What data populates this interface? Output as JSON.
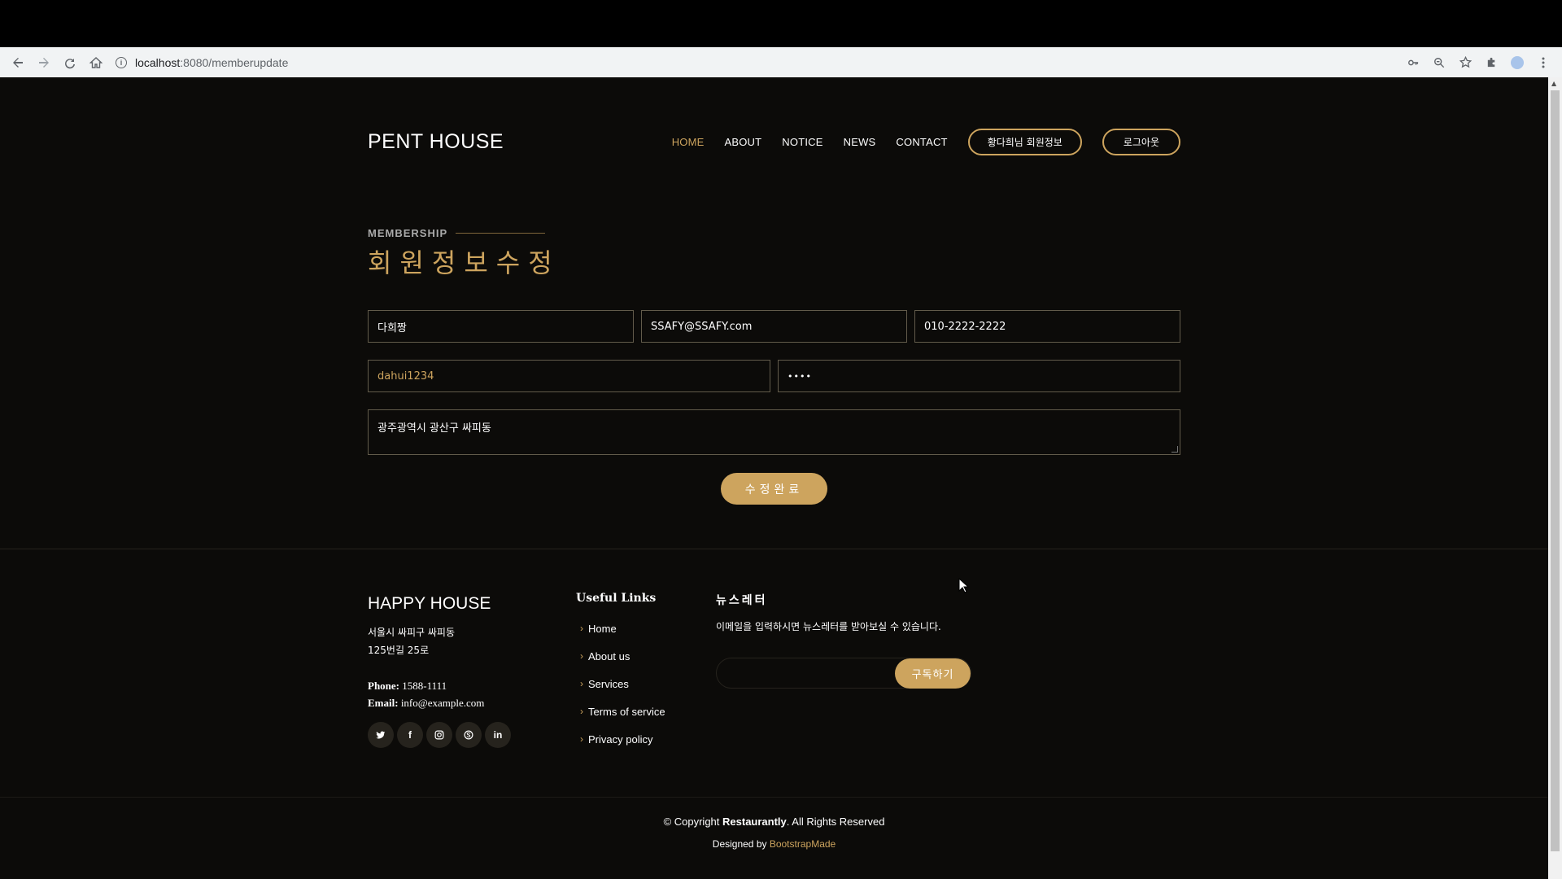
{
  "browser": {
    "url_host": "localhost",
    "url_path": ":8080/memberupdate",
    "icons": [
      "back-icon",
      "forward-icon",
      "reload-icon",
      "home-icon",
      "info-icon",
      "key-icon",
      "zoom-icon",
      "star-icon",
      "extensions-icon",
      "profile-icon",
      "menu-icon"
    ]
  },
  "header": {
    "logo": "PENT HOUSE",
    "nav": [
      "HOME",
      "ABOUT",
      "NOTICE",
      "NEWS",
      "CONTACT"
    ],
    "active_nav": "HOME",
    "profile_button": "황다희님 회원정보",
    "logout_button": "로그아웃"
  },
  "section": {
    "subtitle": "MEMBERSHIP",
    "title": "회원정보수정"
  },
  "form": {
    "name": "다희짱",
    "email": "SSAFY@SSAFY.com",
    "phone": "010-2222-2222",
    "user_id": "dahui1234",
    "password_masked": "••••",
    "address": "광주광역시 광산구 싸피동",
    "submit": "수정완료"
  },
  "footer": {
    "brand": "HAPPY HOUSE",
    "address_line1": "서울시 싸피구 싸피동",
    "address_line2": "125번길 25로",
    "phone_label": "Phone:",
    "phone": "1588-1111",
    "email_label": "Email:",
    "email": "info@example.com",
    "socials": [
      "twitter-icon",
      "facebook-icon",
      "instagram-icon",
      "skype-icon",
      "linkedin-icon"
    ],
    "links_title": "Useful Links",
    "links": [
      "Home",
      "About us",
      "Services",
      "Terms of service",
      "Privacy policy"
    ],
    "newsletter_title": "뉴스레터",
    "newsletter_text": "이메일을 입력하시면 뉴스레터를 받아보실 수 있습니다.",
    "newsletter_button": "구독하기",
    "copyright_prefix": "© Copyright ",
    "copyright_brand": "Restaurantly",
    "copyright_suffix": ". All Rights Reserved",
    "designed_prefix": "Designed by ",
    "designed_brand": "BootstrapMade"
  },
  "colors": {
    "accent": "#cda45e",
    "background": "#0c0b09"
  }
}
